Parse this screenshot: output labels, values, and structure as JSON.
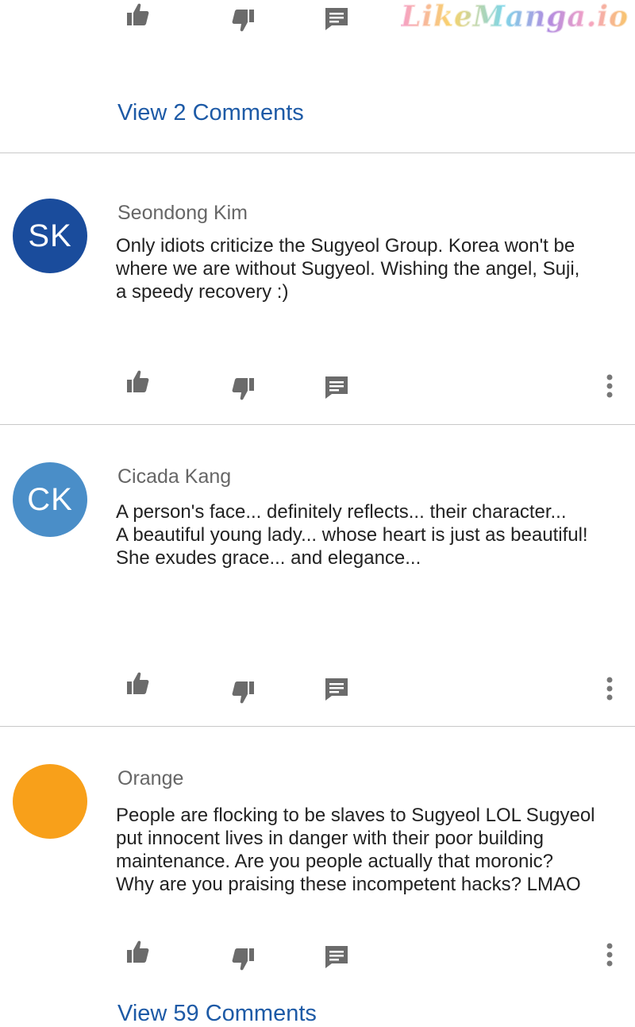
{
  "watermark": "LikeManga.io",
  "top_link": "View 2 Comments",
  "bottom_link": "View  59 Comments",
  "colors": {
    "link": "#1d5aa6",
    "icon": "#6b6b6b"
  },
  "icons": {
    "like": "thumbs-up-icon",
    "dislike": "thumbs-down-icon",
    "reply": "comment-icon",
    "more": "more-vertical-icon"
  },
  "comments": [
    {
      "initials": "SK",
      "avatar_color": "#1a4c9c",
      "author": "Seondong Kim",
      "text": "Only idiots criticize the Sugyeol Group. Korea won't be\n where we are without Sugyeol. Wishing the angel, Suji,\na speedy recovery :)"
    },
    {
      "initials": "CK",
      "avatar_color": "#4a8ec8",
      "author": "Cicada Kang",
      "text": "A person's face... definitely reflects... their character...\nA beautiful young lady... whose heart is just as beautiful!\nShe exudes grace... and elegance..."
    },
    {
      "initials": "",
      "avatar_color": "#f8a01a",
      "author": "Orange",
      "text": "People are flocking to be slaves to Sugyeol LOL Sugyeol\nput innocent lives in danger with their poor building\nmaintenance. Are you people actually that moronic?\nWhy are you praising these incompetent hacks? LMAO"
    }
  ]
}
